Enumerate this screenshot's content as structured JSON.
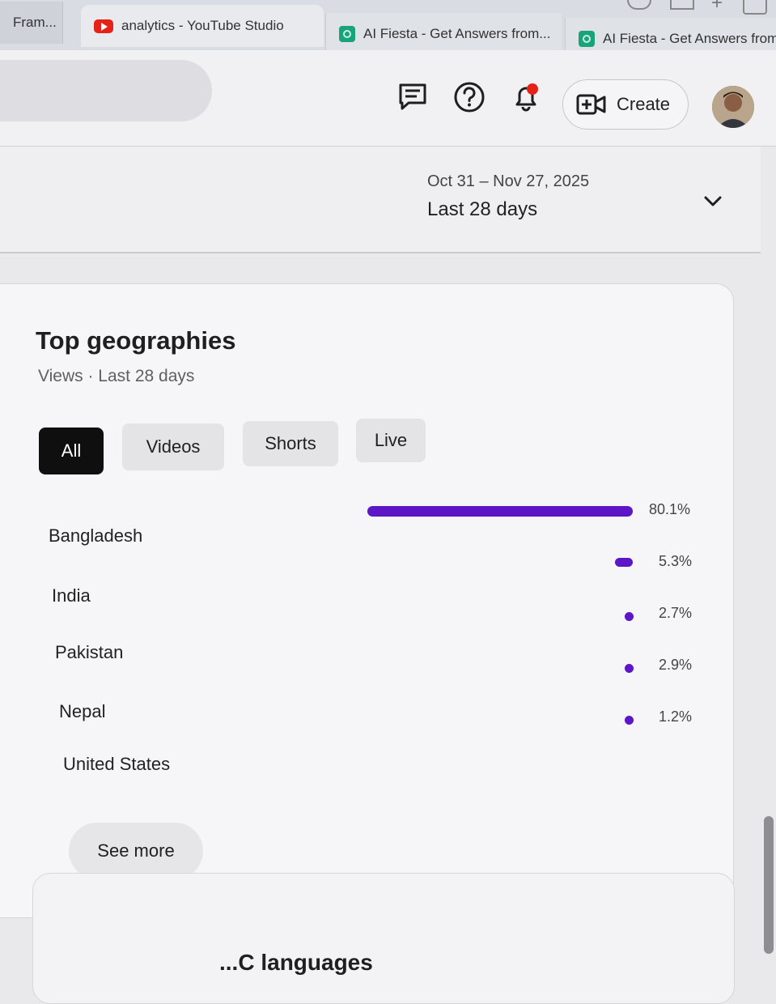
{
  "browser": {
    "tabs": [
      {
        "label": "Fram..."
      },
      {
        "label": "analytics - YouTube Studio",
        "icon": "youtube-icon"
      },
      {
        "label": "AI Fiesta - Get Answers from...",
        "icon": "ai-fiesta-icon"
      },
      {
        "label": "AI Fiesta - Get Answers from...",
        "icon": "ai-fiesta-icon"
      }
    ]
  },
  "header": {
    "create_label": "Create",
    "icons": [
      "feedback-icon",
      "help-icon",
      "notifications-bell-icon",
      "create-video-icon"
    ]
  },
  "date_range": {
    "range": "Oct 31 – Nov 27, 2025",
    "label": "Last 28 days"
  },
  "card": {
    "title": "Top geographies",
    "subtitle": "Views · Last 28 days",
    "chips": [
      {
        "label": "All",
        "selected": true
      },
      {
        "label": "Videos",
        "selected": false
      },
      {
        "label": "Shorts",
        "selected": false
      },
      {
        "label": "Live",
        "selected": false
      }
    ],
    "rows": [
      {
        "country": "Bangladesh",
        "percent": "80.1%",
        "value": 80.1
      },
      {
        "country": "India",
        "percent": "5.3%",
        "value": 5.3
      },
      {
        "country": "Pakistan",
        "percent": "2.7%",
        "value": 2.7
      },
      {
        "country": "Nepal",
        "percent": "2.9%",
        "value": 2.9
      },
      {
        "country": "United States",
        "percent": "1.2%",
        "value": 1.2
      }
    ],
    "see_more": "See more"
  },
  "next_card": {
    "title_partial": "...C languages"
  },
  "colors": {
    "bar": "#5c16c6",
    "selected_chip": "#0f0f0f",
    "youtube_red": "#e62117"
  }
}
